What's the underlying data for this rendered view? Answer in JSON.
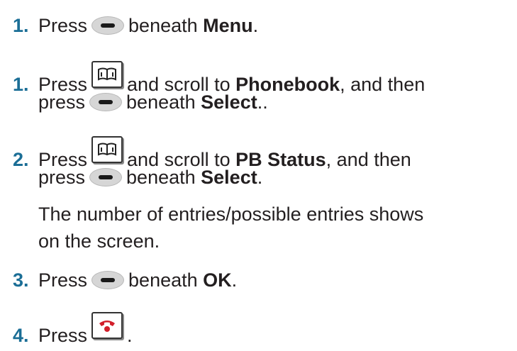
{
  "steps": [
    {
      "num": "1.",
      "pre": "Press",
      "post": "beneath",
      "bold": "Menu",
      "end": "."
    },
    {
      "num": "1.",
      "pre": "Press",
      "mid": "and scroll to",
      "bold": "Phonebook",
      "tail": ", and then",
      "line2_pre": "press",
      "line2_post": "beneath",
      "line2_bold": "Select",
      "line2_end": ".."
    },
    {
      "num": "2.",
      "pre": "Press",
      "mid": "and scroll to",
      "bold": "PB Status",
      "tail": ", and then",
      "line2_pre": "press",
      "line2_post": "beneath",
      "line2_bold": "Select",
      "line2_end": "."
    },
    {
      "num": "3.",
      "pre": "Press",
      "post": "beneath",
      "bold": "OK",
      "end": "."
    },
    {
      "num": "4.",
      "pre": "Press",
      "end": "."
    }
  ],
  "note": {
    "line1": "The number of entries/possible entries shows",
    "line2": "on the screen."
  },
  "icons": {
    "softkey": "softkey-icon",
    "phonebook": "phonebook-key-icon",
    "end_call": "end-call-key-icon"
  }
}
